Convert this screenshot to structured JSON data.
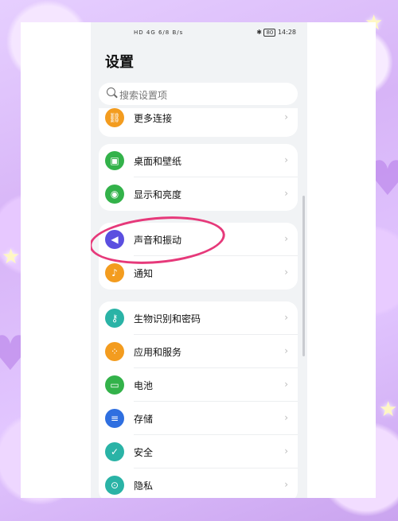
{
  "status_bar": {
    "left_info": "HD 4G 6/8 B/s",
    "battery": "80",
    "time": "14:28"
  },
  "page_title": "设置",
  "search": {
    "placeholder": "搜索设置项"
  },
  "groups": [
    {
      "items": [
        {
          "label": "更多连接",
          "icon": "link-icon",
          "color": "#f39c1f"
        }
      ]
    },
    {
      "items": [
        {
          "label": "桌面和壁纸",
          "icon": "wallpaper-icon",
          "color": "#33b24a"
        },
        {
          "label": "显示和亮度",
          "icon": "eye-icon",
          "color": "#33b24a"
        }
      ]
    },
    {
      "items": [
        {
          "label": "声音和振动",
          "icon": "speaker-icon",
          "color": "#5b4fe0"
        },
        {
          "label": "通知",
          "icon": "bell-icon",
          "color": "#f39c1f"
        }
      ]
    },
    {
      "items": [
        {
          "label": "生物识别和密码",
          "icon": "key-icon",
          "color": "#2ab3a6"
        },
        {
          "label": "应用和服务",
          "icon": "apps-icon",
          "color": "#f39c1f"
        },
        {
          "label": "电池",
          "icon": "battery-icon",
          "color": "#33b24a"
        },
        {
          "label": "存储",
          "icon": "storage-icon",
          "color": "#2f6fe0"
        },
        {
          "label": "安全",
          "icon": "shield-icon",
          "color": "#2ab3a6"
        },
        {
          "label": "隐私",
          "icon": "privacy-icon",
          "color": "#2ab3a6"
        }
      ]
    }
  ]
}
